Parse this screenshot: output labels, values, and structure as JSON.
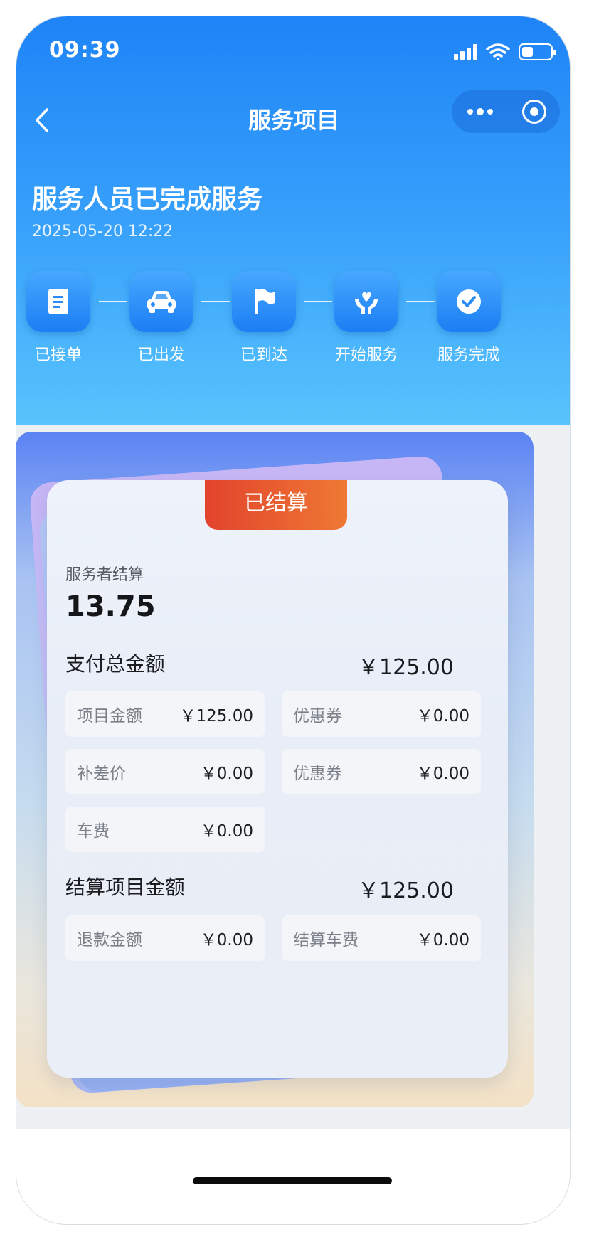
{
  "status_bar": {
    "time": "09:39"
  },
  "nav": {
    "title": "服务项目"
  },
  "order_status": {
    "heading": "服务人员已完成服务",
    "datetime": "2025-05-20 12:22",
    "steps": [
      {
        "label": "已接单",
        "icon": "document-icon"
      },
      {
        "label": "已出发",
        "icon": "car-icon"
      },
      {
        "label": "已到达",
        "icon": "flag-icon"
      },
      {
        "label": "开始服务",
        "icon": "heart-hands-icon"
      },
      {
        "label": "服务完成",
        "icon": "check-circle-icon"
      }
    ]
  },
  "settlement": {
    "tag": "已结算",
    "worker_label": "服务者结算",
    "worker_amount": "13.75",
    "payment_total": {
      "label": "支付总金额",
      "amount": "￥125.00"
    },
    "payment_items": [
      {
        "label": "项目金额",
        "amount": "￥125.00"
      },
      {
        "label": "优惠券",
        "amount": "￥0.00"
      },
      {
        "label": "补差价",
        "amount": "￥0.00"
      },
      {
        "label": "优惠券",
        "amount": "￥0.00"
      },
      {
        "label": "车费",
        "amount": "￥0.00"
      }
    ],
    "settle_total": {
      "label": "结算项目金额",
      "amount": "￥125.00"
    },
    "settle_items": [
      {
        "label": "退款金额",
        "amount": "￥0.00"
      },
      {
        "label": "结算车费",
        "amount": "￥0.00"
      }
    ]
  },
  "colors": {
    "header_top": "#1e84f7",
    "header_bottom": "#58c4fc",
    "tag_red": "#e2432c",
    "tag_orange": "#ef7934"
  }
}
